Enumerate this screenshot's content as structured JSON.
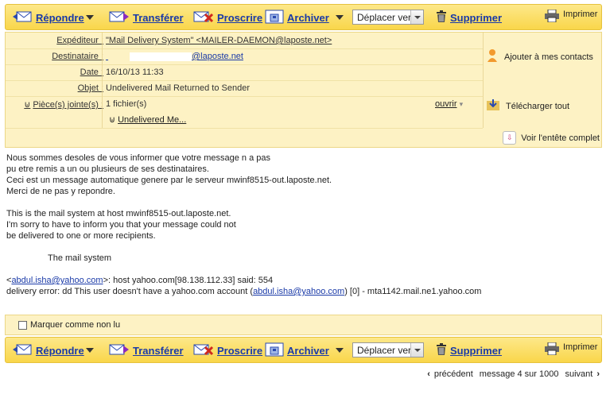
{
  "toolbar": {
    "reply": "Répondre",
    "forward": "Transférer",
    "block": "Proscrire",
    "archive": "Archiver",
    "move_select": "Déplacer vers",
    "delete": "Supprimer",
    "print": "Imprimer"
  },
  "header": {
    "sender_label": "Expéditeur :",
    "sender_value": "\"Mail Delivery System\" <MAILER-DAEMON@laposte.net>",
    "recipient_label": "Destinataire :",
    "recipient_value": "@laposte.net",
    "date_label": "Date :",
    "date_value": "16/10/13 11:33",
    "subject_label": "Objet :",
    "subject_value": "Undelivered Mail Returned to Sender",
    "attachments_label": "Pièce(s) jointe(s) :",
    "attachments_count": "1 fichier(s)",
    "open_label": "ouvrir",
    "attachment_name": "Undelivered Me...",
    "add_contacts": "Ajouter à mes contacts",
    "download_all": "Télécharger tout",
    "full_header": "Voir l'entête complet"
  },
  "body": {
    "lines": [
      "Nous sommes desoles de vous informer que votre message n a pas",
      "pu etre remis a un ou plusieurs de ses destinataires.",
      "Ceci est un message automatique genere par le serveur mwinf8515-out.laposte.net.",
      "Merci de ne pas y repondre.",
      "",
      "This is the mail system at host mwinf8515-out.laposte.net.",
      "I'm sorry to have to inform you that your message could not",
      "be delivered to one or more recipients.",
      "",
      "The mail system",
      ""
    ],
    "error_line1_prefix": "<",
    "error_email": "abdul.isha@yahoo.com",
    "error_line1_suffix": ">: host yahoo.com[98.138.112.33] said: 554",
    "error_line2_prefix": "delivery error: dd This user doesn't have a yahoo.com account (",
    "error_line2_suffix": ") [0] - mta1142.mail.ne1.yahoo.com"
  },
  "mark_unread": "Marquer comme non lu",
  "pager": {
    "previous": "précédent",
    "status": "message 4 sur 1000",
    "next": "suivant"
  }
}
